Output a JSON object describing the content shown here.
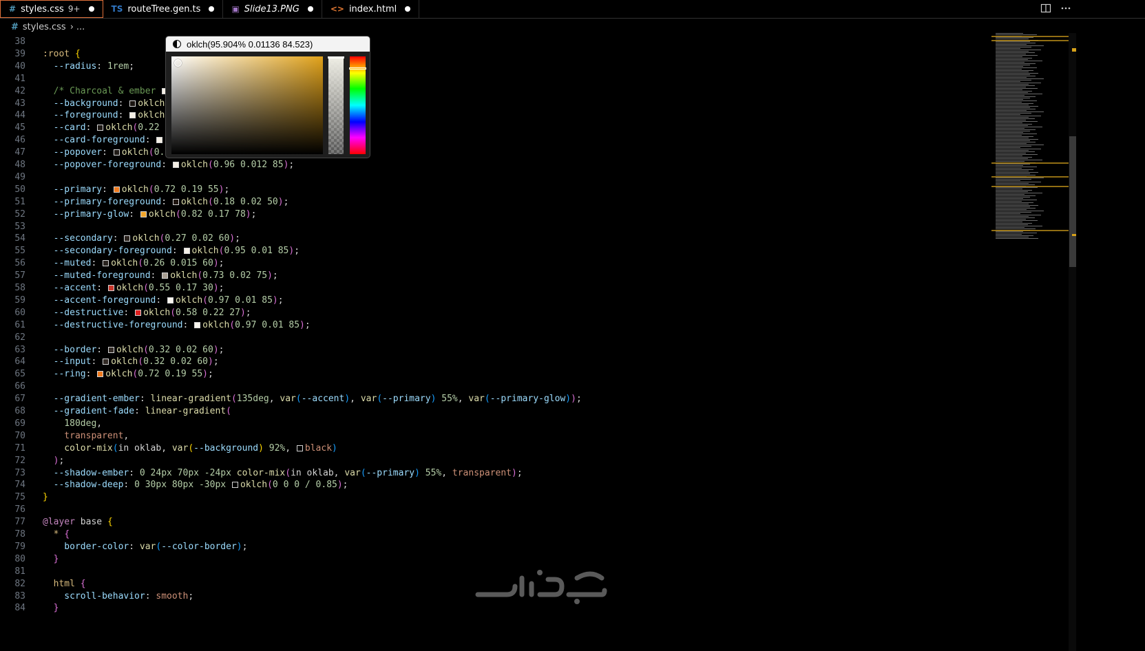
{
  "tabs": [
    {
      "icon": "#",
      "label": "styles.css",
      "modified": "9+",
      "active": true,
      "icon_color": "#519aba"
    },
    {
      "icon": "TS",
      "label": "routeTree.gen.ts",
      "active": false,
      "icon_color": "#3178c6"
    },
    {
      "icon": "▣",
      "label": "Slide13.PNG",
      "active": false,
      "italic": true,
      "icon_color": "#a074c4"
    },
    {
      "icon": "<>",
      "label": "index.html",
      "active": false,
      "icon_color": "#e37933"
    }
  ],
  "breadcrumb": {
    "file": "styles.css",
    "more": "..."
  },
  "color_picker": {
    "value": "oklch(95.904% 0.01136 84.523)",
    "base_color": "#f4efe5",
    "hue_color": "#e1a21a"
  },
  "code_lines": [
    {
      "n": "38",
      "t": []
    },
    {
      "n": "39",
      "t": [
        [
          ":root",
          "sel"
        ],
        [
          " ",
          "pl"
        ],
        [
          "{",
          "br1"
        ]
      ]
    },
    {
      "n": "40",
      "t": [
        [
          "  --radius",
          "prop"
        ],
        [
          ": ",
          "pl"
        ],
        [
          "1rem",
          "num"
        ],
        [
          ";",
          "pl"
        ]
      ]
    },
    {
      "n": "41",
      "t": []
    },
    {
      "n": "42",
      "t": [
        [
          "  /* Charcoal & ember ",
          "com"
        ],
        [
          "sw:#f4efe5",
          "sw"
        ],
        [
          " s",
          "com"
        ]
      ]
    },
    {
      "n": "43",
      "t": [
        [
          "  --background",
          "prop"
        ],
        [
          ": ",
          "pl"
        ],
        [
          "sw:#1a1511",
          "sw"
        ],
        [
          "oklch",
          "fn"
        ],
        [
          "(",
          "br2"
        ]
      ]
    },
    {
      "n": "44",
      "t": [
        [
          "  --foreground",
          "prop"
        ],
        [
          ": ",
          "pl"
        ],
        [
          "sw:#f4efe5",
          "sw"
        ],
        [
          "oklch",
          "fn"
        ],
        [
          "(",
          "br2"
        ]
      ]
    },
    {
      "n": "45",
      "t": [
        [
          "  --card",
          "prop"
        ],
        [
          ": ",
          "pl"
        ],
        [
          "sw:#201b17",
          "sw"
        ],
        [
          "oklch",
          "fn"
        ],
        [
          "(",
          "br2"
        ],
        [
          "0.22 0",
          "num"
        ]
      ]
    },
    {
      "n": "46",
      "t": [
        [
          "  --card-foreground",
          "prop"
        ],
        [
          ": ",
          "pl"
        ],
        [
          "sw:#f4efe5",
          "sw"
        ],
        [
          "ok",
          "fn"
        ]
      ]
    },
    {
      "n": "47",
      "t": [
        [
          "  --popover",
          "prop"
        ],
        [
          ": ",
          "pl"
        ],
        [
          "sw:#201b17",
          "sw"
        ],
        [
          "oklch",
          "fn"
        ],
        [
          "(",
          "br2"
        ],
        [
          "0.2",
          "num"
        ]
      ]
    },
    {
      "n": "48",
      "t": [
        [
          "  --popover-foreground",
          "prop"
        ],
        [
          ": ",
          "pl"
        ],
        [
          "sw:#f4efe5",
          "sw"
        ],
        [
          "oklch",
          "fn"
        ],
        [
          "(",
          "br2"
        ],
        [
          "0.96 0.012 85",
          "num"
        ],
        [
          ")",
          "br2"
        ],
        [
          ";",
          "pl"
        ]
      ]
    },
    {
      "n": "49",
      "t": []
    },
    {
      "n": "50",
      "t": [
        [
          "  --primary",
          "prop"
        ],
        [
          ": ",
          "pl"
        ],
        [
          "sw:#f07a1e",
          "sw"
        ],
        [
          "oklch",
          "fn"
        ],
        [
          "(",
          "br2"
        ],
        [
          "0.72 0.19 55",
          "num"
        ],
        [
          ")",
          "br2"
        ],
        [
          ";",
          "pl"
        ]
      ]
    },
    {
      "n": "51",
      "t": [
        [
          "  --primary-foreground",
          "prop"
        ],
        [
          ": ",
          "pl"
        ],
        [
          "sw:#1f1611",
          "sw"
        ],
        [
          "oklch",
          "fn"
        ],
        [
          "(",
          "br2"
        ],
        [
          "0.18 0.02 50",
          "num"
        ],
        [
          ")",
          "br2"
        ],
        [
          ";",
          "pl"
        ]
      ]
    },
    {
      "n": "52",
      "t": [
        [
          "  --primary-glow",
          "prop"
        ],
        [
          ": ",
          "pl"
        ],
        [
          "sw:#f2a52a",
          "sw"
        ],
        [
          "oklch",
          "fn"
        ],
        [
          "(",
          "br2"
        ],
        [
          "0.82 0.17 78",
          "num"
        ],
        [
          ")",
          "br2"
        ],
        [
          ";",
          "pl"
        ]
      ]
    },
    {
      "n": "53",
      "t": []
    },
    {
      "n": "54",
      "t": [
        [
          "  --secondary",
          "prop"
        ],
        [
          ": ",
          "pl"
        ],
        [
          "sw:#2b231e",
          "sw"
        ],
        [
          "oklch",
          "fn"
        ],
        [
          "(",
          "br2"
        ],
        [
          "0.27 0.02 60",
          "num"
        ],
        [
          ")",
          "br2"
        ],
        [
          ";",
          "pl"
        ]
      ]
    },
    {
      "n": "55",
      "t": [
        [
          "  --secondary-foreground",
          "prop"
        ],
        [
          ": ",
          "pl"
        ],
        [
          "sw:#f3efe6",
          "sw"
        ],
        [
          "oklch",
          "fn"
        ],
        [
          "(",
          "br2"
        ],
        [
          "0.95 0.01 85",
          "num"
        ],
        [
          ")",
          "br2"
        ],
        [
          ";",
          "pl"
        ]
      ]
    },
    {
      "n": "56",
      "t": [
        [
          "  --muted",
          "prop"
        ],
        [
          ": ",
          "pl"
        ],
        [
          "sw:#29231f",
          "sw"
        ],
        [
          "oklch",
          "fn"
        ],
        [
          "(",
          "br2"
        ],
        [
          "0.26 0.015 60",
          "num"
        ],
        [
          ")",
          "br2"
        ],
        [
          ";",
          "pl"
        ]
      ]
    },
    {
      "n": "57",
      "t": [
        [
          "  --muted-foreground",
          "prop"
        ],
        [
          ": ",
          "pl"
        ],
        [
          "sw:#a89f93",
          "sw"
        ],
        [
          "oklch",
          "fn"
        ],
        [
          "(",
          "br2"
        ],
        [
          "0.73 0.02 75",
          "num"
        ],
        [
          ")",
          "br2"
        ],
        [
          ";",
          "pl"
        ]
      ]
    },
    {
      "n": "58",
      "t": [
        [
          "  --accent",
          "prop"
        ],
        [
          ": ",
          "pl"
        ],
        [
          "sw:#c9362a",
          "sw"
        ],
        [
          "oklch",
          "fn"
        ],
        [
          "(",
          "br2"
        ],
        [
          "0.55 0.17 30",
          "num"
        ],
        [
          ")",
          "br2"
        ],
        [
          ";",
          "pl"
        ]
      ]
    },
    {
      "n": "59",
      "t": [
        [
          "  --accent-foreground",
          "prop"
        ],
        [
          ": ",
          "pl"
        ],
        [
          "sw:#f8f5ee",
          "sw"
        ],
        [
          "oklch",
          "fn"
        ],
        [
          "(",
          "br2"
        ],
        [
          "0.97 0.01 85",
          "num"
        ],
        [
          ")",
          "br2"
        ],
        [
          ";",
          "pl"
        ]
      ]
    },
    {
      "n": "60",
      "t": [
        [
          "  --destructive",
          "prop"
        ],
        [
          ": ",
          "pl"
        ],
        [
          "sw:#e0201f",
          "sw"
        ],
        [
          "oklch",
          "fn"
        ],
        [
          "(",
          "br2"
        ],
        [
          "0.58 0.22 27",
          "num"
        ],
        [
          ")",
          "br2"
        ],
        [
          ";",
          "pl"
        ]
      ]
    },
    {
      "n": "61",
      "t": [
        [
          "  --destructive-foreground",
          "prop"
        ],
        [
          ": ",
          "pl"
        ],
        [
          "sw:#f8f5ee",
          "sw"
        ],
        [
          "oklch",
          "fn"
        ],
        [
          "(",
          "br2"
        ],
        [
          "0.97 0.01 85",
          "num"
        ],
        [
          ")",
          "br2"
        ],
        [
          ";",
          "pl"
        ]
      ]
    },
    {
      "n": "62",
      "t": []
    },
    {
      "n": "63",
      "t": [
        [
          "  --border",
          "prop"
        ],
        [
          ": ",
          "pl"
        ],
        [
          "sw:#332b26",
          "sw"
        ],
        [
          "oklch",
          "fn"
        ],
        [
          "(",
          "br2"
        ],
        [
          "0.32 0.02 60",
          "num"
        ],
        [
          ")",
          "br2"
        ],
        [
          ";",
          "pl"
        ]
      ]
    },
    {
      "n": "64",
      "t": [
        [
          "  --input",
          "prop"
        ],
        [
          ": ",
          "pl"
        ],
        [
          "sw:#332b26",
          "sw"
        ],
        [
          "oklch",
          "fn"
        ],
        [
          "(",
          "br2"
        ],
        [
          "0.32 0.02 60",
          "num"
        ],
        [
          ")",
          "br2"
        ],
        [
          ";",
          "pl"
        ]
      ]
    },
    {
      "n": "65",
      "t": [
        [
          "  --ring",
          "prop"
        ],
        [
          ": ",
          "pl"
        ],
        [
          "sw:#f07a1e",
          "sw"
        ],
        [
          "oklch",
          "fn"
        ],
        [
          "(",
          "br2"
        ],
        [
          "0.72 0.19 55",
          "num"
        ],
        [
          ")",
          "br2"
        ],
        [
          ";",
          "pl"
        ]
      ]
    },
    {
      "n": "66",
      "t": []
    },
    {
      "n": "67",
      "t": [
        [
          "  --gradient-ember",
          "prop"
        ],
        [
          ": ",
          "pl"
        ],
        [
          "linear-gradient",
          "fn"
        ],
        [
          "(",
          "br2"
        ],
        [
          "135deg",
          "num"
        ],
        [
          ", ",
          "pl"
        ],
        [
          "var",
          "fn"
        ],
        [
          "(",
          "br3"
        ],
        [
          "--accent",
          "prop"
        ],
        [
          ")",
          "br3"
        ],
        [
          ", ",
          "pl"
        ],
        [
          "var",
          "fn"
        ],
        [
          "(",
          "br3"
        ],
        [
          "--primary",
          "prop"
        ],
        [
          ")",
          "br3"
        ],
        [
          " ",
          "pl"
        ],
        [
          "55%",
          "num"
        ],
        [
          ", ",
          "pl"
        ],
        [
          "var",
          "fn"
        ],
        [
          "(",
          "br3"
        ],
        [
          "--primary-glow",
          "prop"
        ],
        [
          ")",
          "br3"
        ],
        [
          ")",
          "br2"
        ],
        [
          ";",
          "pl"
        ]
      ]
    },
    {
      "n": "68",
      "t": [
        [
          "  --gradient-fade",
          "prop"
        ],
        [
          ": ",
          "pl"
        ],
        [
          "linear-gradient",
          "fn"
        ],
        [
          "(",
          "br2"
        ]
      ]
    },
    {
      "n": "69",
      "t": [
        [
          "    180deg",
          "num"
        ],
        [
          ",",
          "pl"
        ]
      ]
    },
    {
      "n": "70",
      "t": [
        [
          "    transparent",
          "str"
        ],
        [
          ",",
          "pl"
        ]
      ]
    },
    {
      "n": "71",
      "t": [
        [
          "    color-mix",
          "fn"
        ],
        [
          "(",
          "br3"
        ],
        [
          "in oklab, ",
          "pl"
        ],
        [
          "var",
          "fn"
        ],
        [
          "(",
          "br1"
        ],
        [
          "--background",
          "prop"
        ],
        [
          ")",
          "br1"
        ],
        [
          " ",
          "pl"
        ],
        [
          "92%",
          "num"
        ],
        [
          ", ",
          "pl"
        ],
        [
          "sw:#000000",
          "sw"
        ],
        [
          "black",
          "str"
        ],
        [
          ")",
          "br3"
        ]
      ]
    },
    {
      "n": "72",
      "t": [
        [
          "  ",
          "pl"
        ],
        [
          ")",
          "br2"
        ],
        [
          ";",
          "pl"
        ]
      ]
    },
    {
      "n": "73",
      "t": [
        [
          "  --shadow-ember",
          "prop"
        ],
        [
          ": ",
          "pl"
        ],
        [
          "0 24px 70px -24px ",
          "num"
        ],
        [
          "color-mix",
          "fn"
        ],
        [
          "(",
          "br2"
        ],
        [
          "in oklab, ",
          "pl"
        ],
        [
          "var",
          "fn"
        ],
        [
          "(",
          "br3"
        ],
        [
          "--primary",
          "prop"
        ],
        [
          ")",
          "br3"
        ],
        [
          " ",
          "pl"
        ],
        [
          "55%",
          "num"
        ],
        [
          ", ",
          "pl"
        ],
        [
          "transparent",
          "str"
        ],
        [
          ")",
          "br2"
        ],
        [
          ";",
          "pl"
        ]
      ]
    },
    {
      "n": "74",
      "t": [
        [
          "  --shadow-deep",
          "prop"
        ],
        [
          ": ",
          "pl"
        ],
        [
          "0 30px 80px -30px ",
          "num"
        ],
        [
          "sw:#000000",
          "sw"
        ],
        [
          "oklch",
          "fn"
        ],
        [
          "(",
          "br2"
        ],
        [
          "0 0 0 / 0.85",
          "num"
        ],
        [
          ")",
          "br2"
        ],
        [
          ";",
          "pl"
        ]
      ]
    },
    {
      "n": "75",
      "t": [
        [
          "}",
          "br1"
        ]
      ]
    },
    {
      "n": "76",
      "t": []
    },
    {
      "n": "77",
      "t": [
        [
          "@layer",
          "kw"
        ],
        [
          " base ",
          "pl"
        ],
        [
          "{",
          "br1"
        ]
      ]
    },
    {
      "n": "78",
      "t": [
        [
          "  * ",
          "sel"
        ],
        [
          "{",
          "br2"
        ]
      ]
    },
    {
      "n": "79",
      "t": [
        [
          "    border-color",
          "prop"
        ],
        [
          ": ",
          "pl"
        ],
        [
          "var",
          "fn"
        ],
        [
          "(",
          "br3"
        ],
        [
          "--color-border",
          "prop"
        ],
        [
          ")",
          "br3"
        ],
        [
          ";",
          "pl"
        ]
      ]
    },
    {
      "n": "80",
      "t": [
        [
          "  ",
          "pl"
        ],
        [
          "}",
          "br2"
        ]
      ]
    },
    {
      "n": "81",
      "t": []
    },
    {
      "n": "82",
      "t": [
        [
          "  html ",
          "sel"
        ],
        [
          "{",
          "br2"
        ]
      ]
    },
    {
      "n": "83",
      "t": [
        [
          "    scroll-behavior",
          "prop"
        ],
        [
          ": ",
          "pl"
        ],
        [
          "smooth",
          "str"
        ],
        [
          ";",
          "pl"
        ]
      ]
    },
    {
      "n": "84",
      "t": [
        [
          "  ",
          "pl"
        ],
        [
          "}",
          "br2"
        ]
      ]
    }
  ]
}
